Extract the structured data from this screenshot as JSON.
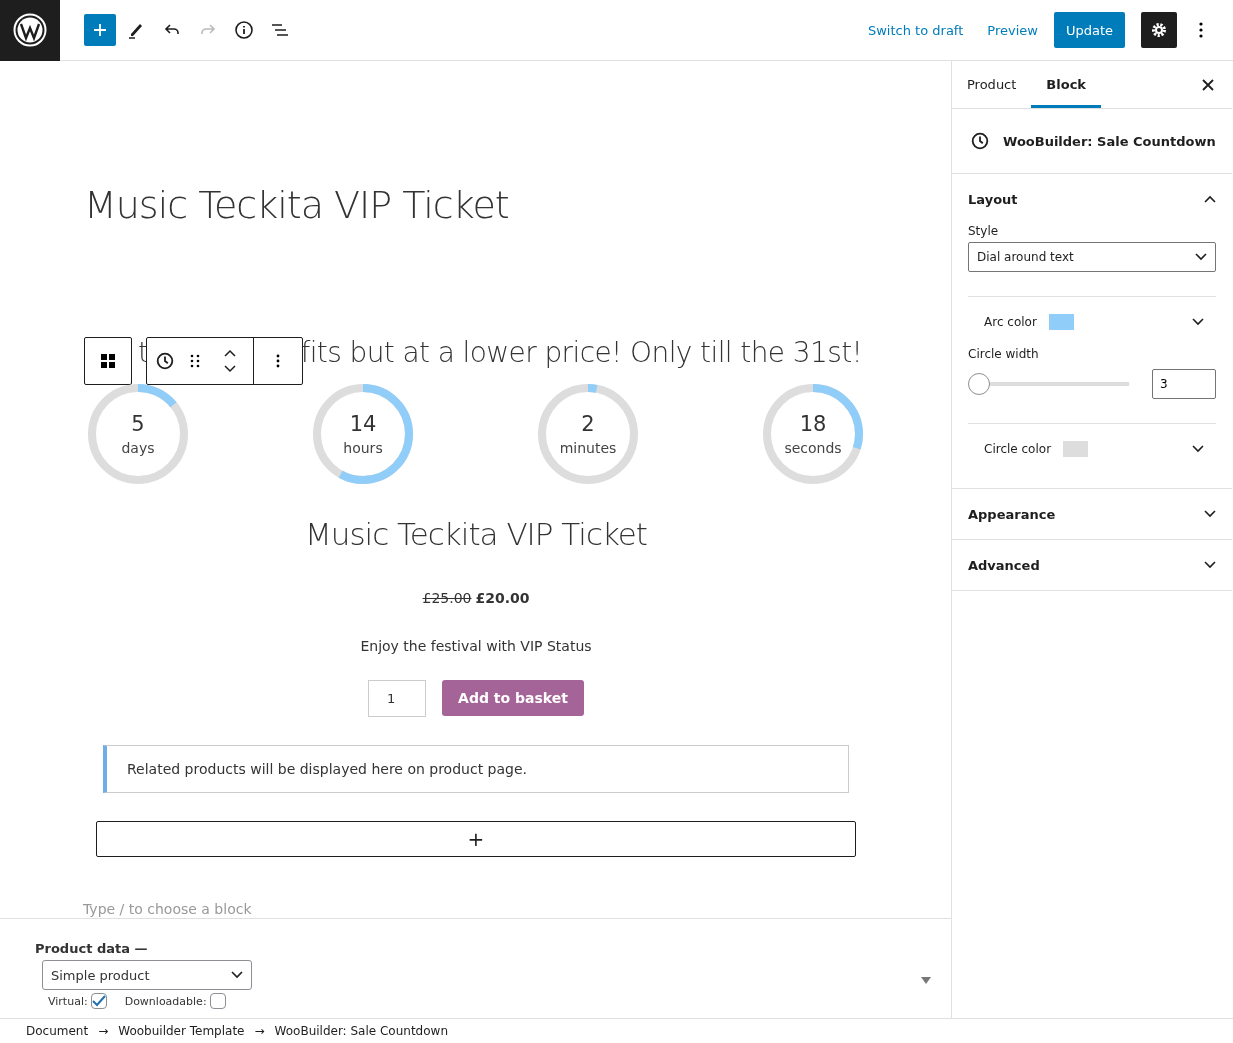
{
  "top_bar": {
    "switch_to_draft": "Switch to draft",
    "preview": "Preview",
    "update": "Update"
  },
  "editor": {
    "title": "Music Teckita VIP Ticket",
    "heading_parts": [
      "t",
      "fits but at a lower price! Only till the 31st!"
    ],
    "countdown": [
      {
        "value": "5",
        "unit": "days",
        "level": 0.14
      },
      {
        "value": "14",
        "unit": "hours",
        "level": 0.58
      },
      {
        "value": "2",
        "unit": "minutes",
        "level": 0.03
      },
      {
        "value": "18",
        "unit": "seconds",
        "level": 0.3
      }
    ],
    "product_title": "Music Teckita VIP Ticket",
    "price_old": "£25.00",
    "price_new": "£20.00",
    "description": "Enjoy the festival with VIP Status",
    "quantity": "1",
    "add_to_basket": "Add to basket",
    "related_notice": "Related products will be displayed here on product page.",
    "appender": "+",
    "placeholder": "Type / to choose a block"
  },
  "product_data": {
    "label": "Product data —",
    "type": "Simple product",
    "options": [
      {
        "label": "Virtual:",
        "checked": true
      },
      {
        "label": "Downloadable:",
        "checked": false
      }
    ]
  },
  "breadcrumb": {
    "separator": "→",
    "items": [
      "Document",
      "Woobuilder Template",
      "WooBuilder: Sale Countdown"
    ]
  },
  "sidebar": {
    "tabs": [
      {
        "label": "Product",
        "selected": false
      },
      {
        "label": "Block",
        "selected": true
      }
    ],
    "block_name": "WooBuilder: Sale Countdown",
    "panels": [
      {
        "title": "Layout",
        "expanded": true
      },
      {
        "title": "Appearance",
        "expanded": false
      },
      {
        "title": "Advanced",
        "expanded": false
      }
    ],
    "layout": {
      "style_label": "Style",
      "style_value": "Dial around text",
      "arc_color": {
        "label": "Arc color",
        "color": "#90cdf8"
      },
      "circle_width": {
        "label": "Circle width",
        "level": 0,
        "value": "3"
      },
      "circle_color": {
        "label": "Circle color",
        "color": "#dddddd"
      }
    }
  }
}
